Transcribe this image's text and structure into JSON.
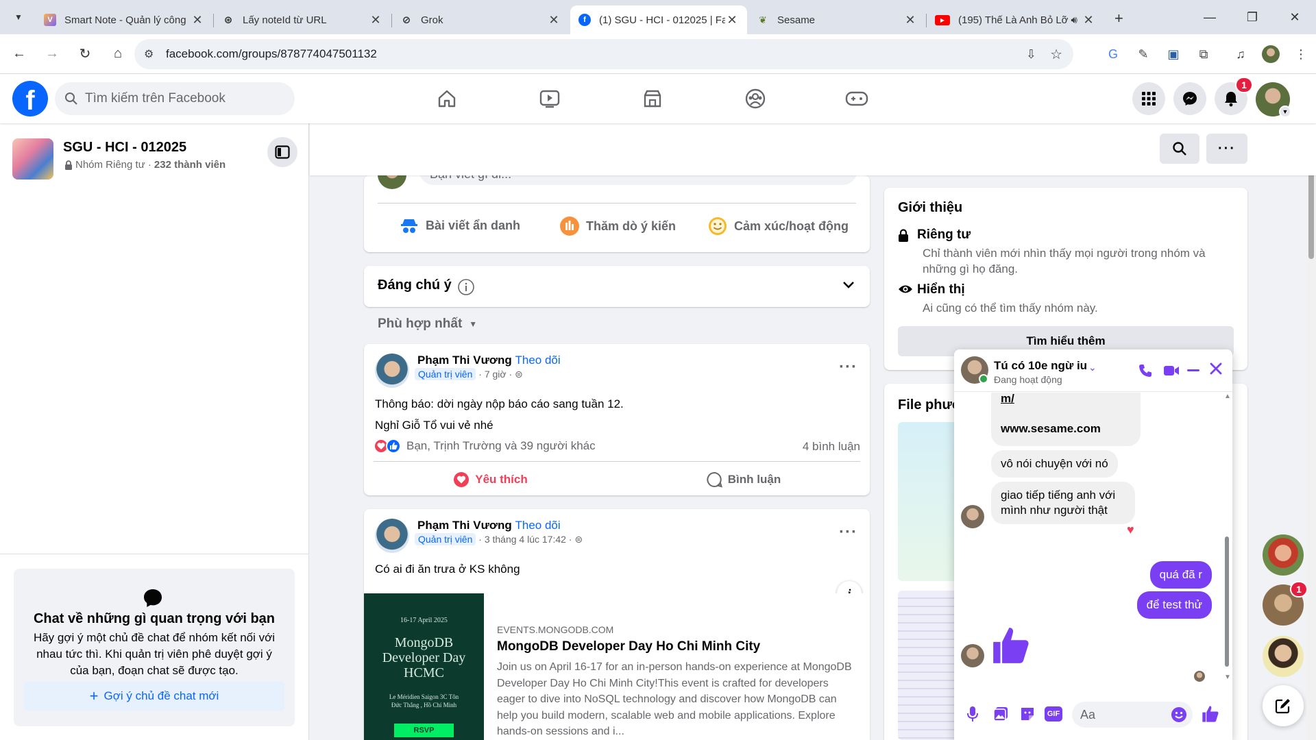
{
  "browser": {
    "tabs": [
      {
        "title": "Smart Note - Quản lý công",
        "icon": "v-icon",
        "color": "#7b61ff"
      },
      {
        "title": "Lấy noteId từ URL",
        "icon": "openai-icon",
        "color": "#333333"
      },
      {
        "title": "Grok",
        "icon": "grok-icon",
        "color": "#333333"
      },
      {
        "title": "(1) SGU - HCI - 012025 | Fa",
        "icon": "facebook-icon",
        "color": "#0866ff"
      },
      {
        "title": "Sesame",
        "icon": "sesame-icon",
        "color": "#5a7a2a"
      },
      {
        "title": "(195) Thế Là Anh Bỏ Lỡ",
        "icon": "youtube-icon",
        "color": "#ff0000"
      }
    ],
    "url": "facebook.com/groups/878774047501132"
  },
  "fb": {
    "search_placeholder": "Tìm kiếm trên Facebook",
    "notif_count": "1",
    "side_badge": "1"
  },
  "group": {
    "name": "SGU - HCI - 012025",
    "privacy": "Nhóm Riêng tư ·",
    "members": "232 thành viên"
  },
  "sidebar_chat": {
    "title": "Chat về những gì quan trọng với bạn",
    "desc": "Hãy gợi ý một chủ đề chat để nhóm kết nối với nhau tức thì. Khi quản trị viên phê duyệt gợi ý của bạn, đoạn chat sẽ được tạo.",
    "button": "Gợi ý chủ đề chat mới"
  },
  "composer": {
    "placeholder": "Bạn viết gì đi...",
    "actions": [
      "Bài viết ẩn danh",
      "Thăm dò ý kiến",
      "Cảm xúc/hoạt động"
    ]
  },
  "featured": {
    "title": "Đáng chú ý"
  },
  "sort": {
    "label": "Phù hợp nhất"
  },
  "posts": [
    {
      "author": "Phạm Thi Vương",
      "follow": "Theo dõi",
      "role": "Quản trị viên",
      "time": "· 7 giờ ·",
      "lines": [
        "Thông báo: dời ngày nộp báo cáo sang tuần 12.",
        "Nghỉ Giỗ Tổ vui vẻ nhé"
      ],
      "reactions": "Bạn, Trịnh Trường và 39 người khác",
      "comments": "4 bình luận",
      "like": "Yêu thích",
      "comment_btn": "Bình luận"
    },
    {
      "author": "Phạm Thi Vương",
      "follow": "Theo dõi",
      "role": "Quản trị viên",
      "time": "· 3 tháng 4 lúc 17:42 ·",
      "lines": [
        "Có ai đi ăn trưa ở KS không"
      ],
      "link": {
        "domain": "EVENTS.MONGODB.COM",
        "title": "MongoDB Developer Day Ho Chi Minh City",
        "desc": "Join us on April 16-17 for an in-person hands-on experience at MongoDB Developer Day Ho Chi Minh City!This event is crafted for developers eager to dive into NoSQL technology and discover how MongoDB can help you build modern, scalable web and mobile applications. Explore hands-on sessions and i...",
        "thumb_date": "16-17 April 2025",
        "thumb_title": "MongoDB Developer Day HCMC",
        "thumb_venue": "Le Méridien Saigon 3C Tôn Đức Thắng , Hồ Chí Minh",
        "thumb_btn": "RSVP"
      }
    }
  ],
  "intro": {
    "title": "Giới thiệu",
    "private_title": "Riêng tư",
    "private_desc": "Chỉ thành viên mới nhìn thấy mọi người trong nhóm và những gì họ đăng.",
    "visible_title": "Hiển thị",
    "visible_desc": "Ai cũng có thể tìm thấy nhóm này.",
    "learn_more": "Tìm hiểu thêm"
  },
  "files": {
    "title": "File phươ"
  },
  "chat": {
    "name": "Tú có 10e ngừ iu",
    "status": "Đang hoạt động",
    "messages": [
      {
        "text": "m/",
        "from": "them"
      },
      {
        "text": "www.sesame.com",
        "from": "them"
      },
      {
        "text": "vô nói chuyện với nó",
        "from": "them"
      },
      {
        "text": "giao tiếp tiếng anh với mình như người thật",
        "from": "them"
      },
      {
        "text": "quá đã r",
        "from": "me"
      },
      {
        "text": "để test thử",
        "from": "me"
      }
    ],
    "input_placeholder": "Aa"
  }
}
